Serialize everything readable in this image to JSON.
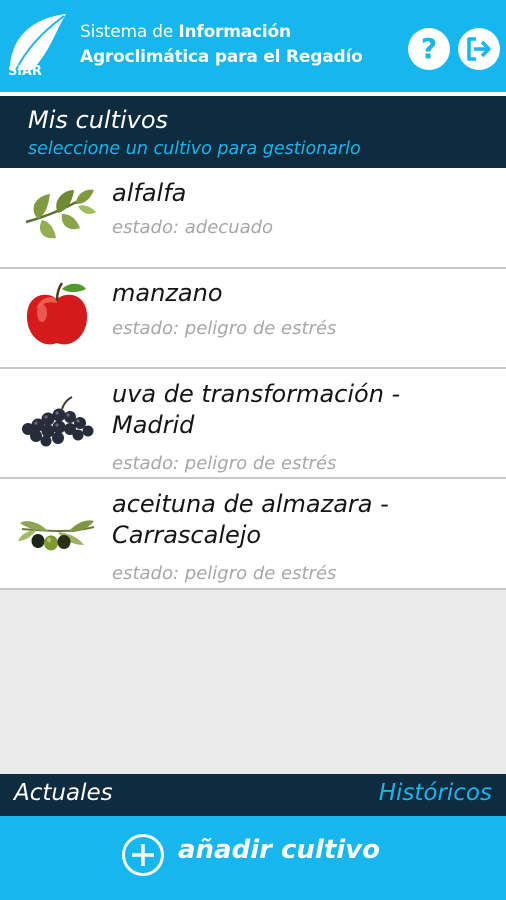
{
  "header": {
    "logo_text": "SiAR",
    "title_line1_light": "Sistema de ",
    "title_line1_bold": "Información",
    "title_line2": "Agroclimática para el Regadío",
    "help_label": "?",
    "help_icon": "question-icon",
    "exit_icon": "logout-arrow-icon"
  },
  "section": {
    "title": "Mis cultivos",
    "subtitle": "seleccione un cultivo para gestionarlo"
  },
  "crops": [
    {
      "name": "alfalfa",
      "status": "estado: adecuado",
      "icon": "alfalfa-leaves-icon"
    },
    {
      "name": "manzano",
      "status": "estado: peligro de estrés",
      "icon": "apple-icon"
    },
    {
      "name": "uva de transformación - Madrid",
      "status": "estado: peligro de estrés",
      "icon": "grapes-icon"
    },
    {
      "name": "aceituna de almazara - Carrascalejo",
      "status": "estado: peligro de estrés",
      "icon": "olives-icon"
    }
  ],
  "tabs": {
    "actuales": "Actuales",
    "historicos": "Históricos"
  },
  "add": {
    "label": "añadir cultivo",
    "icon": "plus-circle-icon"
  },
  "colors": {
    "accent": "#16b6ef",
    "dark": "#0f2b3e",
    "background": "#ebebeb",
    "status_text": "#a7a7a7"
  }
}
